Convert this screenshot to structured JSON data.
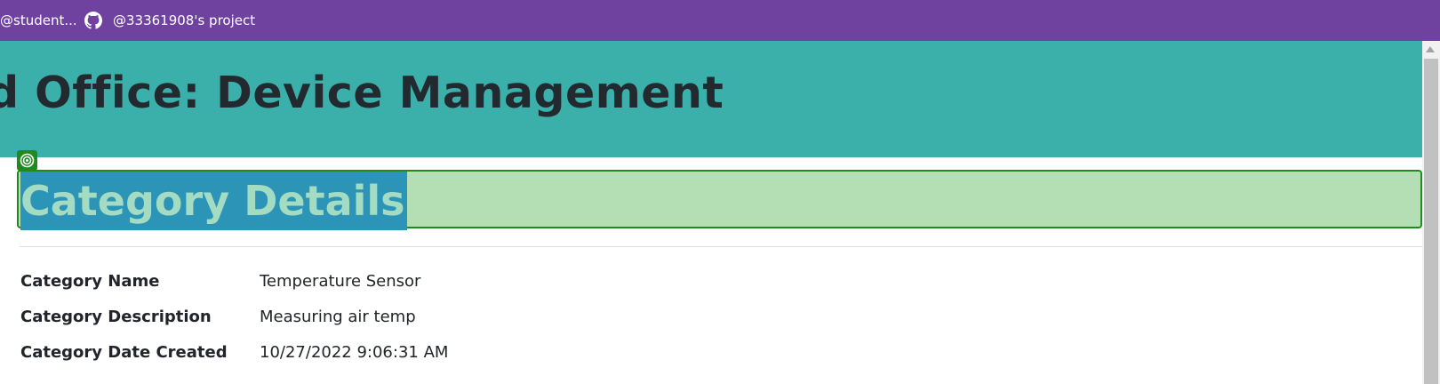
{
  "topbar": {
    "user_label": "@student...",
    "project_label": "@33361908's project",
    "bg_color": "#6f42a0"
  },
  "header": {
    "title": "d Office: Device Management",
    "bg_color": "#3bafaa"
  },
  "inspector": {
    "badge_icon": "inspect-target-icon",
    "highlight_color": "#1f8a1f"
  },
  "page": {
    "heading": "Category Details"
  },
  "details": [
    {
      "label": "Category Name",
      "value": "Temperature Sensor"
    },
    {
      "label": "Category Description",
      "value": "Measuring air temp"
    },
    {
      "label": "Category Date Created",
      "value": "10/27/2022 9:06:31 AM"
    }
  ]
}
